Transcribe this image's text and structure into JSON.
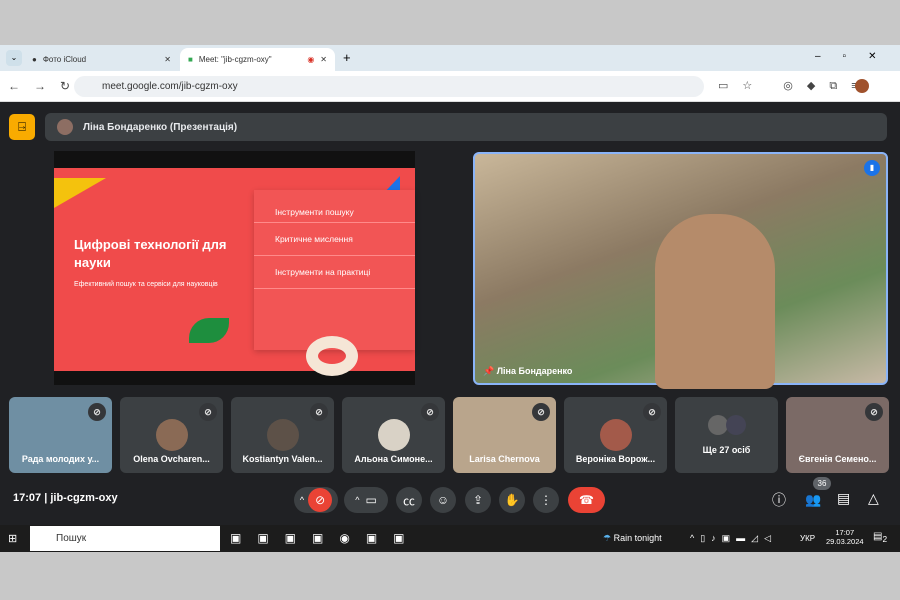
{
  "browser": {
    "tabs": [
      {
        "title": "Фото iCloud"
      },
      {
        "title": "Meet: \"jib-cgzm-oxy\""
      }
    ],
    "url": "meet.google.com/jib-cgzm-oxy"
  },
  "meet": {
    "presenter_title": "Ліна Бондаренко (Презентація)",
    "slide": {
      "title": "Цифрові технології для науки",
      "subtitle": "Ефективний пошук та сервіси для науковців",
      "items": [
        "Інструменти пошуку",
        "Критичне мислення",
        "Інструменти на практиці"
      ]
    },
    "speaker_name": "Ліна Бондаренко",
    "participants": [
      "Рада молодих у...",
      "Olena Ovcharen...",
      "Kostiantyn Valen...",
      "Альона Симоне...",
      "Larisa Chernova",
      "Вероніка Ворож...",
      "Ще 27 осіб",
      "Євгенія Семено..."
    ],
    "time": "17:07",
    "meeting_code": "jib-cgzm-oxy",
    "participant_count": "36"
  },
  "taskbar": {
    "search": "Пошук",
    "weather": "Rain tonight",
    "lang": "УКР",
    "time": "17:07",
    "date": "29.03.2024",
    "notifications": "2"
  },
  "colors": {
    "slide_red": "#f04b4b",
    "end_call": "#ea4335",
    "speaker_border": "#8ab4f8"
  }
}
